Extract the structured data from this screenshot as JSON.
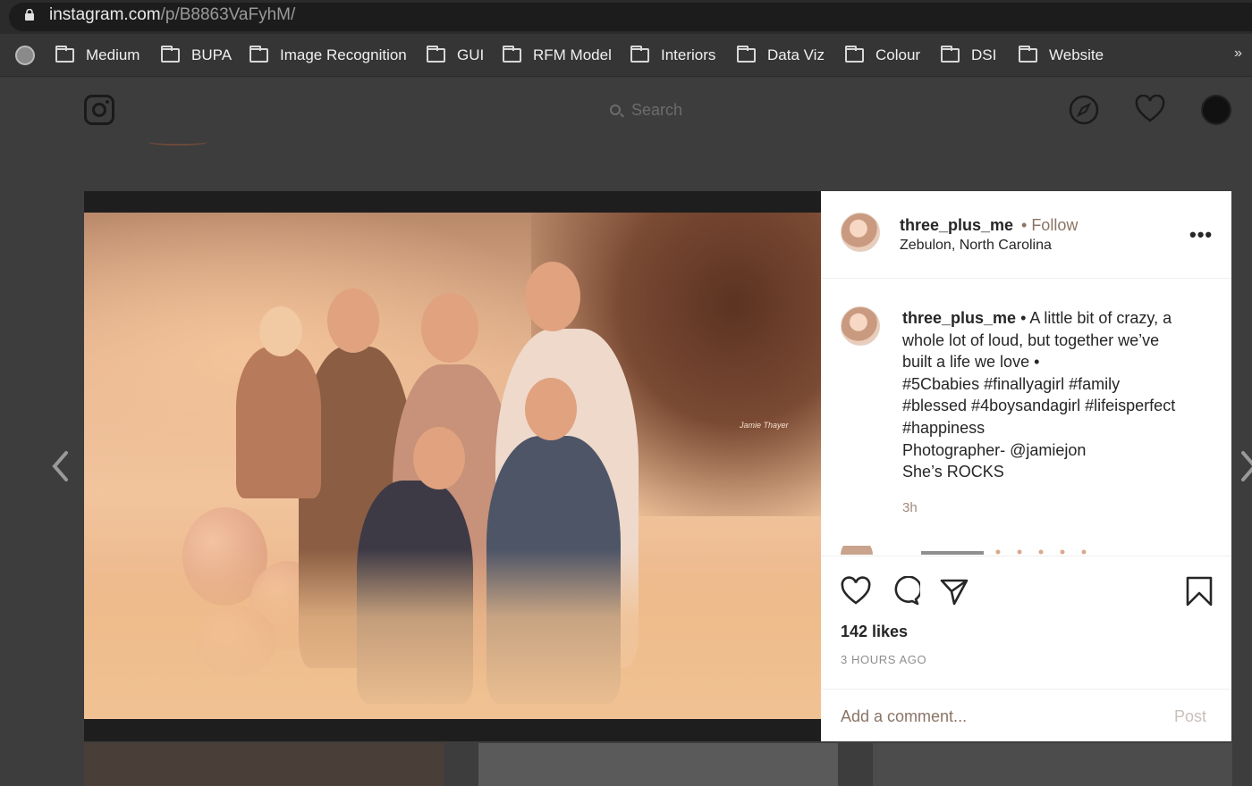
{
  "browser": {
    "url_host": "instagram.com",
    "url_path": "/p/B8863VaFyhM/",
    "bookmarks": [
      "Medium",
      "BUPA",
      "Image Recognition",
      "GUI",
      "RFM Model",
      "Interiors",
      "Data Viz",
      "Colour",
      "DSI",
      "Website"
    ],
    "overflow": "»"
  },
  "header": {
    "search_placeholder": "Search"
  },
  "photo": {
    "watermark": "Jamie Thayer"
  },
  "post": {
    "username": "three_plus_me",
    "separator": " • ",
    "follow_label": "Follow",
    "location": "Zebulon, North Carolina",
    "more_label": "•••",
    "caption_lines": [
      "A little bit of crazy, a",
      "whole lot of loud, but together we’ve",
      "built a life we love •",
      "#5Cbabies #finallyagirl #family",
      "#blessed #4boysandagirl #lifeisperfect",
      "#happiness",
      "Photographer- @jamiejon",
      "She’s ROCKS"
    ],
    "caption_time": "3h",
    "likes": "142 likes",
    "time_ago": "3 HOURS AGO",
    "comment_placeholder": "Add a comment...",
    "post_label": "Post"
  },
  "icons": {
    "compass": "compass-icon",
    "heart": "heart-icon",
    "comment": "comment-icon",
    "share": "share-icon",
    "bookmark": "bookmark-icon"
  }
}
